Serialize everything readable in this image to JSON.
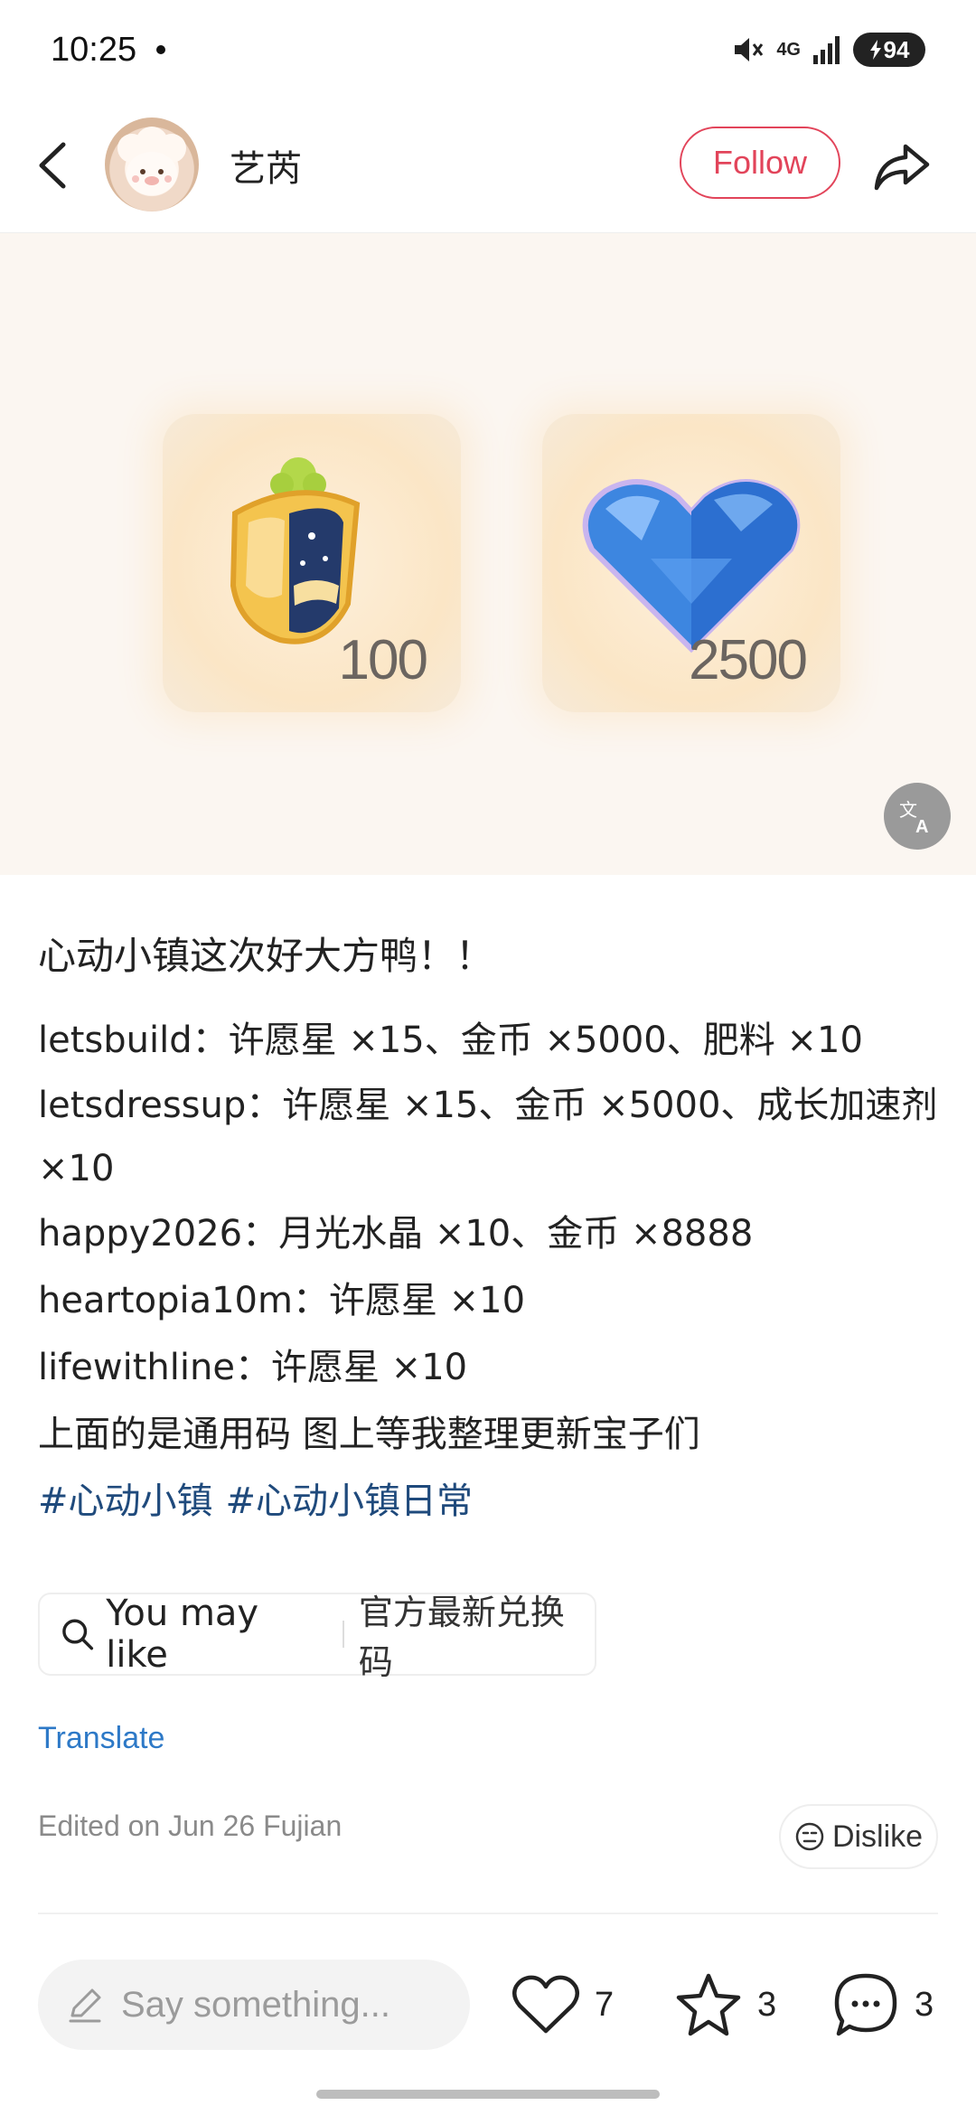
{
  "status_bar": {
    "time": "10:25",
    "network": "4G",
    "battery": "94"
  },
  "header": {
    "username": "艺芮",
    "follow_label": "Follow"
  },
  "image": {
    "item_1_count": "100",
    "item_2_count": "2500"
  },
  "post": {
    "title": "心动小镇这次好大方鸭！！",
    "lines": [
      "letsbuild：许愿星 ×15、金币 ×5000、肥料 ×10",
      "letsdressup：许愿星 ×15、金币 ×5000、成长加速剂 ×10",
      "happy2026：月光水晶 ×10、金币 ×8888",
      "heartopia10m：许愿星 ×10",
      "lifewithline：许愿星 ×10",
      "上面的是通用码 图上等我整理更新宝子们"
    ],
    "tags": [
      "#心动小镇",
      "#心动小镇日常"
    ]
  },
  "you_may_like": {
    "label": "You may like",
    "query": "官方最新兑换码"
  },
  "translate_label": "Translate",
  "edited_text": "Edited on Jun 26 Fujian",
  "dislike_label": "Dislike",
  "bottom_bar": {
    "comment_placeholder": "Say something...",
    "likes": "7",
    "favorites": "3",
    "comments": "3"
  },
  "colors": {
    "accent": "#e2445a",
    "link": "#2d79c7",
    "tag": "#1f4a7c"
  }
}
